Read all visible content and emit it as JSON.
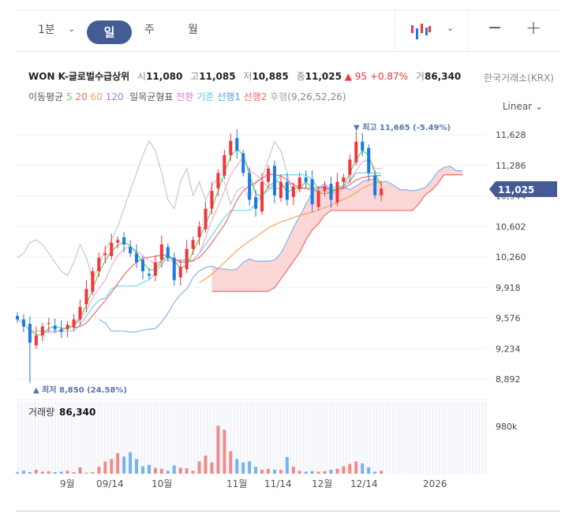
{
  "toolbar": {
    "interval": "1분",
    "tabs": [
      "일",
      "주",
      "월"
    ],
    "active_tab": "일",
    "zoom_out": "−",
    "zoom_in": "+"
  },
  "stock": {
    "name": "WON K-글로벌수급상위",
    "open_label": "시",
    "open": "11,080",
    "high_label": "고",
    "high": "11,085",
    "low_label": "저",
    "low": "10,885",
    "close_label": "종",
    "close": "11,025",
    "change": "▲ 95",
    "change_pct": "+0.87%",
    "volume_label": "거",
    "volume": "86,340",
    "exchange": "한국거래소(KRX)"
  },
  "legend": {
    "ma_label": "이동평균",
    "ma": [
      "5",
      "20",
      "60",
      "120"
    ],
    "ichimoku_label": "일목균형표",
    "ichimoku": [
      "전환",
      "기준",
      "선행1",
      "선행2",
      "후행"
    ],
    "ichimoku_params": "(9,26,52,26)"
  },
  "scale_mode": "Linear",
  "colors": {
    "up": "#f0363b",
    "down": "#1a7ae0",
    "ma5": "#5fcf5a",
    "ma20": "#f26a6a",
    "ma60": "#f5a15f",
    "ma120": "#a978f5",
    "conv": "#f7a8d8",
    "base": "#6cd6ee",
    "spanA": "#7fb4ee",
    "cloud": "#fbd1d1",
    "lag": "#c8c8c8",
    "accent": "#435c96"
  },
  "chart_data": {
    "type": "candlestick",
    "y_ticks": [
      "11,628",
      "11,286",
      "10,944",
      "10,602",
      "10,260",
      "9,918",
      "9,576",
      "9,234",
      "8,892"
    ],
    "ylim": [
      8892,
      11628
    ],
    "x_labels": [
      "9월",
      "09/14",
      "10월",
      "11월",
      "11/14",
      "12월",
      "12/14",
      "2026"
    ],
    "last_price": "11,025",
    "max_label": "▼ 최고 11,665 (-5.49%)",
    "min_label": "▲ 최저 8,850 (24.58%)",
    "closes": [
      9560,
      9480,
      9300,
      9380,
      9480,
      9520,
      9450,
      9420,
      9500,
      9560,
      9700,
      9900,
      10100,
      10250,
      10300,
      10420,
      10450,
      10400,
      10300,
      10200,
      10100,
      10050,
      10200,
      10400,
      10250,
      10000,
      10150,
      10350,
      10450,
      10600,
      10800,
      11000,
      11200,
      11400,
      11560,
      11450,
      11200,
      10900,
      10800,
      11100,
      11250,
      10950,
      11100,
      10900,
      11050,
      11150,
      11100,
      10850,
      11000,
      11050,
      10900,
      11100,
      11150,
      11350,
      11550,
      11450,
      11200,
      10950,
      11025
    ],
    "min_low": 8850,
    "max_high": 11665,
    "volume_label": "거래량",
    "volume": "86,340",
    "volume_tick": "980k",
    "volumes": [
      30,
      60,
      30,
      80,
      40,
      50,
      30,
      40,
      60,
      30,
      130,
      20,
      30,
      140,
      250,
      300,
      420,
      350,
      440,
      300,
      150,
      180,
      120,
      100,
      60,
      170,
      120,
      110,
      60,
      250,
      370,
      230,
      980,
      900,
      460,
      300,
      230,
      250,
      140,
      80,
      100,
      80,
      80,
      340,
      140,
      60,
      40,
      50,
      40,
      50,
      80,
      100,
      150,
      200,
      250,
      210,
      130,
      40,
      60
    ],
    "volume_max": 1000
  }
}
